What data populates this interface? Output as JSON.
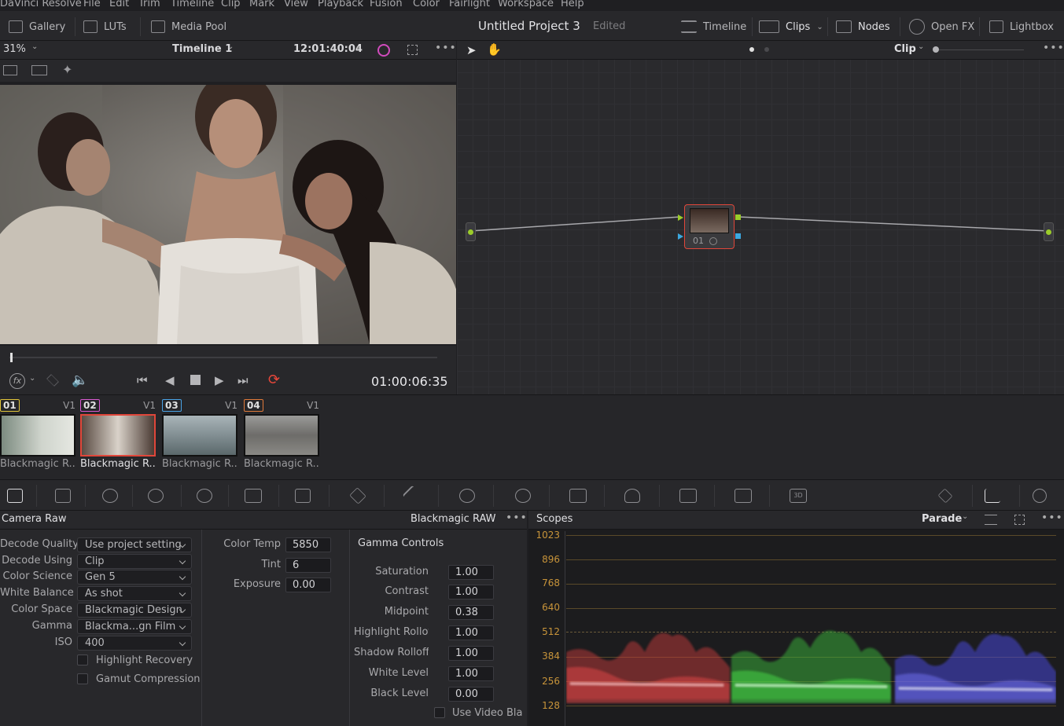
{
  "menu": [
    "DaVinci Resolve",
    "File",
    "Edit",
    "Trim",
    "Timeline",
    "Clip",
    "Mark",
    "View",
    "Playback",
    "Fusion",
    "Color",
    "Fairlight",
    "Workspace",
    "Help"
  ],
  "topbar": {
    "gallery": "Gallery",
    "luts": "LUTs",
    "media_pool": "Media Pool",
    "project_title": "Untitled Project 3",
    "status": "Edited",
    "timeline": "Timeline",
    "clips": "Clips",
    "nodes": "Nodes",
    "open_fx": "Open FX",
    "lightbox": "Lightbox"
  },
  "viewer": {
    "zoom": "31%",
    "timeline_name": "Timeline 1",
    "timecode_top": "12:01:40:04",
    "timecode": "01:00:06:35"
  },
  "nodes": {
    "mode": "Clip",
    "node_label": "01"
  },
  "clips": [
    {
      "num": "01",
      "track": "V1",
      "name": "Blackmagic R...",
      "num_color": "#e1c43a"
    },
    {
      "num": "02",
      "track": "V1",
      "name": "Blackmagic R...",
      "num_color": "#d95ad0"
    },
    {
      "num": "03",
      "track": "V1",
      "name": "Blackmagic R...",
      "num_color": "#4aa3e6"
    },
    {
      "num": "04",
      "track": "V1",
      "name": "Blackmagic R...",
      "num_color": "#e07a3a"
    }
  ],
  "camera_raw": {
    "title": "Camera Raw",
    "format": "Blackmagic RAW",
    "fields": [
      {
        "label": "Decode Quality",
        "value": "Use project setting"
      },
      {
        "label": "Decode Using",
        "value": "Clip"
      },
      {
        "label": "Color Science",
        "value": "Gen 5"
      },
      {
        "label": "White Balance",
        "value": "As shot"
      },
      {
        "label": "Color Space",
        "value": "Blackmagic Design"
      },
      {
        "label": "Gamma",
        "value": "Blackma...gn Film"
      },
      {
        "label": "ISO",
        "value": "400"
      }
    ],
    "highlight_recovery": "Highlight Recovery",
    "gamut_compression": "Gamut Compression",
    "color_temp_label": "Color Temp",
    "color_temp": "5850",
    "tint_label": "Tint",
    "tint": "6",
    "exposure_label": "Exposure",
    "exposure": "0.00",
    "gamma_controls": "Gamma Controls",
    "gamma_fields": [
      {
        "label": "Saturation",
        "value": "1.00"
      },
      {
        "label": "Contrast",
        "value": "1.00"
      },
      {
        "label": "Midpoint",
        "value": "0.38"
      },
      {
        "label": "Highlight Rolloff",
        "value": "1.00"
      },
      {
        "label": "Shadow Rolloff",
        "value": "1.00"
      },
      {
        "label": "White Level",
        "value": "1.00"
      },
      {
        "label": "Black Level",
        "value": "0.00"
      }
    ],
    "use_video_black": "Use Video Blac"
  },
  "scopes": {
    "title": "Scopes",
    "mode": "Parade",
    "ticks": [
      "1023",
      "896",
      "768",
      "640",
      "512",
      "384",
      "256",
      "128"
    ]
  }
}
